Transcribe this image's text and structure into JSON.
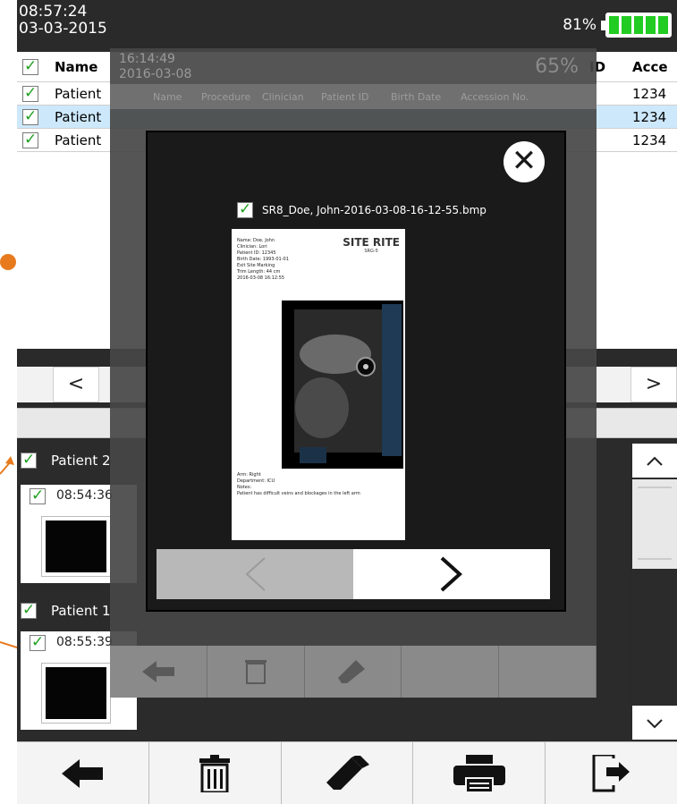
{
  "status": {
    "time": "08:57:24",
    "date": "03-03-2015",
    "battery_pct": "81%"
  },
  "table": {
    "headers": {
      "name": "Name",
      "id": "ID",
      "accession": "Acce"
    },
    "rows": [
      {
        "name": "Patient",
        "accession": "1234",
        "selected": false
      },
      {
        "name": "Patient",
        "accession": "1234",
        "selected": true
      },
      {
        "name": "Patient",
        "accession": "1234",
        "selected": false
      }
    ]
  },
  "nav": {
    "prev": "<",
    "next": ">"
  },
  "lower": {
    "groups": [
      {
        "label": "Patient 2",
        "thumb_time": "08:54:36"
      },
      {
        "label": "Patient 1",
        "thumb_time": "08:55:39"
      }
    ]
  },
  "overlay": {
    "time": "16:14:49",
    "date": "2016-03-08",
    "battery_pct": "65%",
    "columns": [
      "Name",
      "Procedure",
      "Clinician",
      "Patient ID",
      "Birth Date",
      "Accession No."
    ],
    "filename": "SR8_Doe, John-2016-03-08-16-12-55.bmp",
    "report": {
      "logo": "SITE RITE",
      "model": "SRG-5",
      "info": [
        "Name: Doe, John",
        "Clinician: Lori",
        "Patient ID: 12345",
        "Birth Date: 1993-01-01",
        "Exit Site Marking",
        "Trim Length: 44 cm",
        "2016-03-08 16:12:55"
      ],
      "footer": [
        "Arm: Right",
        "Department: ICU",
        "Notes:",
        "Patient has difficult veins and blockages in the left arm"
      ]
    }
  },
  "colors": {
    "accent": "#e87a1e",
    "check": "#20a020",
    "battery": "#22cc22",
    "selected_row": "#cde8fb"
  },
  "toolbar_icons": [
    "back-arrow-icon",
    "trash-icon",
    "usb-drive-icon",
    "printer-icon",
    "export-icon"
  ]
}
